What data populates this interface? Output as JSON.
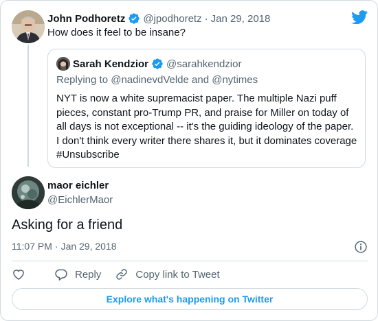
{
  "parent_tweet": {
    "author_name": "John Podhoretz",
    "handle": "@jpodhoretz",
    "separator": "·",
    "date": "Jan 29, 2018",
    "text": "How does it feel to be insane?"
  },
  "quoted_tweet": {
    "author_name": "Sarah Kendzior",
    "handle": "@sarahkendzior",
    "replying_to": "Replying to @nadinevdVelde and @nytimes",
    "text": "NYT is now a white supremacist paper. The multiple Nazi puff pieces, constant pro-Trump PR, and praise for Miller on today of all days is not exceptional -- it's the guiding ideology of the paper. I don't think every writer there shares it, but it dominates coverage #Unsubscribe"
  },
  "main_tweet": {
    "author_name": "maor eichler",
    "handle": "@EichlerMaor",
    "text": "Asking for a friend",
    "time": "11:07 PM",
    "separator": "·",
    "date": "Jan 29, 2018"
  },
  "actions": {
    "reply_label": "Reply",
    "copy_link_label": "Copy link to Tweet"
  },
  "explore_button": {
    "label": "Explore what's happening on Twitter"
  },
  "colors": {
    "twitter_blue": "#1d9bf0",
    "verified_blue": "#1d9bf0",
    "secondary_text": "#536471",
    "border": "#cfd9de"
  }
}
